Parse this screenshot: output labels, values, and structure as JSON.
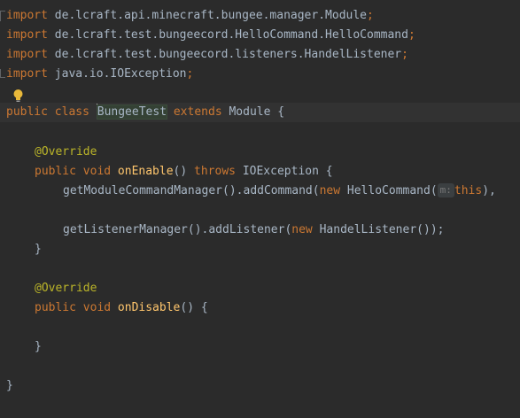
{
  "code": {
    "imports": [
      {
        "kw": "import",
        "path": "de.lcraft.api.minecraft.bungee.manager.Module",
        "end": ";"
      },
      {
        "kw": "import",
        "path": "de.lcraft.test.bungeecord.HelloCommand.HelloCommand",
        "end": ";"
      },
      {
        "kw": "import",
        "path": "de.lcraft.test.bungeecord.listeners.HandelListener",
        "end": ";"
      },
      {
        "kw": "import",
        "path": "java.io.IOException",
        "end": ";"
      }
    ],
    "class_line": {
      "kw1": "public class ",
      "name": "BungeeTest",
      "kw2": " extends ",
      "parent": "Module",
      "brace": " {"
    },
    "method1": {
      "annotation": "@Override",
      "kw": "public void ",
      "name": "onEnable",
      "paren": "() ",
      "throws": "throws ",
      "exc": "IOException",
      "brace": " {",
      "stmt1_a": "getModuleCommandManager().addCommand(",
      "stmt1_new": "new ",
      "stmt1_cls": "HelloCommand(",
      "stmt1_hint": "m:",
      "stmt1_this": "this",
      "stmt1_end": "),",
      "stmt2_a": "getListenerManager().addListener(",
      "stmt2_new": "new ",
      "stmt2_b": "HandelListener());",
      "close": "}"
    },
    "method2": {
      "annotation": "@Override",
      "kw": "public void ",
      "name": "onDisable",
      "paren": "() {",
      "close": "}"
    },
    "class_close": "}"
  },
  "colors": {
    "background": "#2b2b2b",
    "keyword": "#cc7832",
    "function": "#ffc66d",
    "annotation": "#bbb529",
    "text": "#a9b7c6"
  },
  "icons": {
    "intention": "lightbulb-icon"
  }
}
